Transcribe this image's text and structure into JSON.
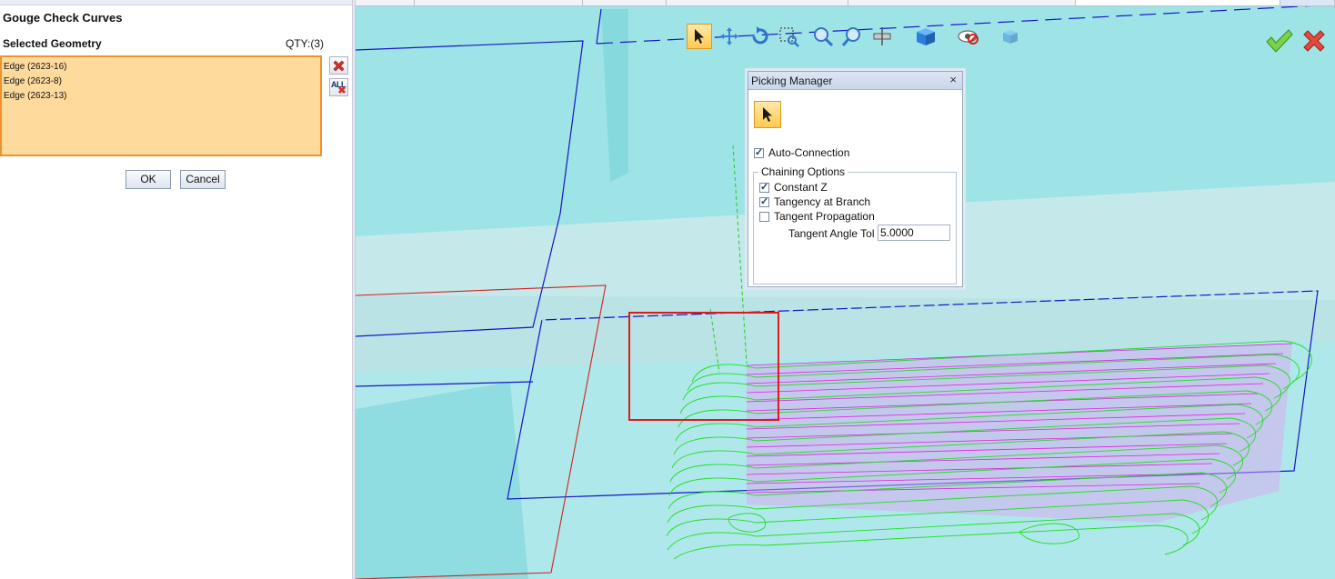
{
  "panel": {
    "title": "Gouge Check Curves",
    "selected_label": "Selected Geometry",
    "qty": "QTY:(3)",
    "items": [
      "Edge (2623-16)",
      "Edge (2623-8)",
      "Edge (2623-13)"
    ],
    "remove_icon": "red-x-remove-icon",
    "remove_all_icon": "remove-all-icon",
    "remove_all_label": "ALL",
    "ok_label": "OK",
    "cancel_label": "Cancel"
  },
  "toolbar": {
    "icons": [
      "select-arrow-icon",
      "pan-icon",
      "rotate-icon",
      "zoom-window-icon",
      "zoom-icon",
      "zoom-fit-icon",
      "section-icon",
      "shading-icon",
      "hide-icon",
      "view-cube-icon"
    ],
    "accept_icon": "green-check-icon",
    "cancel_icon": "red-x-icon"
  },
  "picking_manager": {
    "title": "Picking Manager",
    "close": "×",
    "auto_connection": {
      "label": "Auto-Connection",
      "checked": true
    },
    "chaining_options_label": "Chaining Options",
    "constant_z": {
      "label": "Constant Z",
      "checked": true
    },
    "tangency_at_branch": {
      "label": "Tangency at Branch",
      "checked": true
    },
    "tangent_propagation": {
      "label": "Tangent Propagation",
      "checked": false
    },
    "tangent_angle_tol_label": "Tangent Angle Tol",
    "tangent_angle_tol_value": "5.0000"
  },
  "colors": {
    "accent_orange": "#f0922b",
    "list_bg": "#fedb9c",
    "viewport_bg": "#aee8ea",
    "toolpath_green": "#22dd22",
    "toolpath_magenta": "#e022e0",
    "boundary_blue": "#1515c8",
    "boundary_red": "#d42020",
    "highlight_red": "#e11919"
  }
}
